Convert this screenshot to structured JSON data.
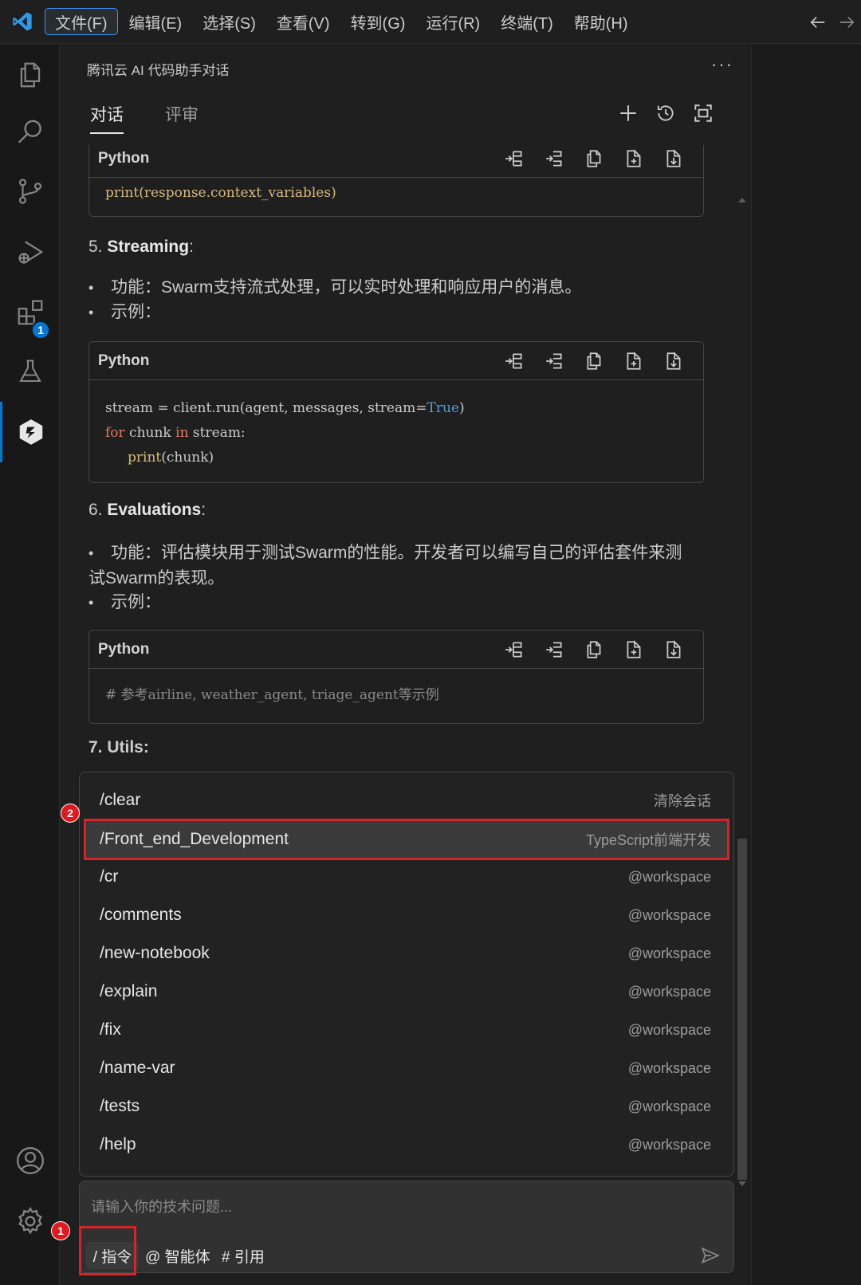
{
  "menubar": {
    "items": [
      "文件(F)",
      "编辑(E)",
      "选择(S)",
      "查看(V)",
      "转到(G)",
      "运行(R)",
      "终端(T)",
      "帮助(H)"
    ]
  },
  "activitybar": {
    "icons": [
      "explorer-icon",
      "search-icon",
      "source-control-icon",
      "run-debug-icon",
      "extensions-icon",
      "testing-icon",
      "tencent-ai-icon",
      "account-icon",
      "settings-icon"
    ],
    "extensions_badge": "1"
  },
  "panel": {
    "title": "腾讯云 AI 代码助手对话",
    "more": "···",
    "tabs": [
      {
        "label": "对话",
        "active": true
      },
      {
        "label": "评审",
        "active": false
      }
    ]
  },
  "chat": {
    "block1": {
      "lang": "Python",
      "line": "print(response.context_variables)"
    },
    "section5": {
      "num": "5. ",
      "title": "Streaming",
      "suffix": ":"
    },
    "s5_bullets": [
      "功能：Swarm支持流式处理，可以实时处理和响应用户的消息。",
      "示例："
    ],
    "block2": {
      "lang": "Python",
      "l1": {
        "a": "stream = client.run(agent, messages, stream=",
        "b": "True",
        "c": ")"
      },
      "l2": {
        "a": "for",
        "b": " chunk ",
        "c": "in",
        "d": " stream:"
      },
      "l3": {
        "a": "print",
        "b": "(chunk)"
      }
    },
    "section6": {
      "num": "6. ",
      "title": "Evaluations",
      "suffix": ":"
    },
    "s6_bullets": [
      "功能：评估模块用于测试Swarm的性能。开发者可以编写自己的评估套件来测试Swarm的表现。",
      "示例："
    ],
    "block3": {
      "lang": "Python",
      "line": "# 参考airline, weather_agent, triage_agent等示例"
    },
    "section7": "7. Utils:"
  },
  "dropdown": {
    "items": [
      {
        "cmd": "/clear",
        "desc": "清除会话"
      },
      {
        "cmd": "/Front_end_Development",
        "desc": "TypeScript前端开发"
      },
      {
        "cmd": "/cr",
        "desc": "@workspace"
      },
      {
        "cmd": "/comments",
        "desc": "@workspace"
      },
      {
        "cmd": "/new-notebook",
        "desc": "@workspace"
      },
      {
        "cmd": "/explain",
        "desc": "@workspace"
      },
      {
        "cmd": "/fix",
        "desc": "@workspace"
      },
      {
        "cmd": "/name-var",
        "desc": "@workspace"
      },
      {
        "cmd": "/tests",
        "desc": "@workspace"
      },
      {
        "cmd": "/help",
        "desc": "@workspace"
      }
    ],
    "selected_index": 1
  },
  "input": {
    "placeholder": "请输入你的技术问题...",
    "chips": [
      "/ 指令",
      "@ 智能体",
      "# 引用"
    ]
  },
  "markers": [
    "1",
    "2"
  ],
  "colors": {
    "accent": "#0078d4",
    "highlight": "#d8232a",
    "bg": "#1f1f1f"
  }
}
